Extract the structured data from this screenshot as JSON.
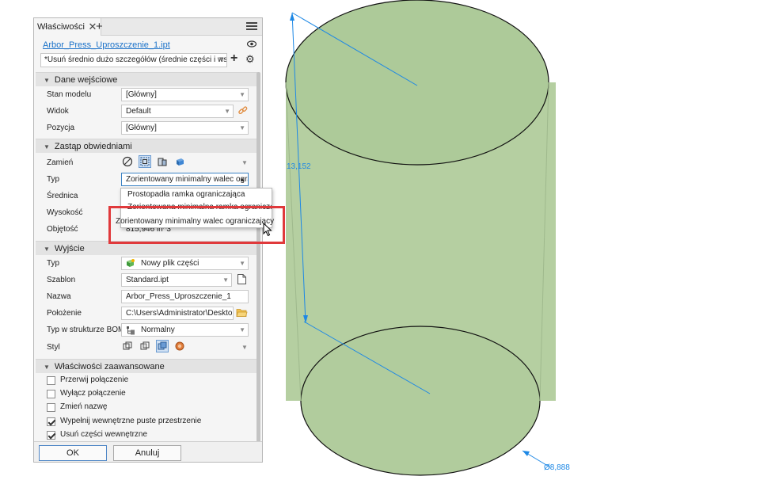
{
  "panel": {
    "tab_label": "Właściwości",
    "file_name": "Arbor_Press_Uproszczenie_1.ipt",
    "preset": "*Usuń średnio dużo szczegółów (średnie części i wszystk"
  },
  "sections": {
    "input": {
      "title": "Dane wejściowe",
      "model_state_label": "Stan modelu",
      "model_state_value": "[Główny]",
      "view_label": "Widok",
      "view_value": "Default",
      "position_label": "Pozycja",
      "position_value": "[Główny]"
    },
    "envelope": {
      "title": "Zastąp obwiedniami",
      "replace_label": "Zamień",
      "type_label": "Typ",
      "type_value": "Zorientowany minimalny walec ograniczający",
      "diameter_label": "Średnica",
      "height_label": "Wysokość",
      "volume_label": "Objętość",
      "volume_value": "815,946 in^3"
    },
    "output": {
      "title": "Wyjście",
      "type_label": "Typ",
      "type_value": "Nowy plik części",
      "template_label": "Szablon",
      "template_value": "Standard.ipt",
      "name_label": "Nazwa",
      "name_value": "Arbor_Press_Uproszczenie_1",
      "location_label": "Położenie",
      "location_value": "C:\\Users\\Administrator\\Desktop\\Sar",
      "bom_label": "Typ w strukturze BOM",
      "bom_value": "Normalny",
      "style_label": "Styl"
    },
    "advanced": {
      "title": "Właściwości zaawansowane",
      "options": [
        {
          "label": "Przerwij połączenie",
          "checked": false
        },
        {
          "label": "Wyłącz połączenie",
          "checked": false
        },
        {
          "label": "Zmień nazwę",
          "checked": false
        },
        {
          "label": "Wypełnij wewnętrzne puste przestrzenie",
          "checked": true
        },
        {
          "label": "Usuń części wewnętrzne",
          "checked": true
        }
      ]
    }
  },
  "dropdown": {
    "items": [
      "Prostopadła ramka ograniczająca",
      "Zorientowana minimalna ramka ograniczająca",
      "Zorientowany minimalny walec ograniczający"
    ]
  },
  "buttons": {
    "ok": "OK",
    "cancel": "Anuluj"
  },
  "viewport": {
    "dimension_height": "13,152",
    "dimension_diameter": "Ø8,888",
    "cylinder_color": "#b5cfa1",
    "dimension_color": "#1e88e5"
  },
  "colors": {
    "callout": "#e0393b",
    "link": "#1b72c9"
  }
}
